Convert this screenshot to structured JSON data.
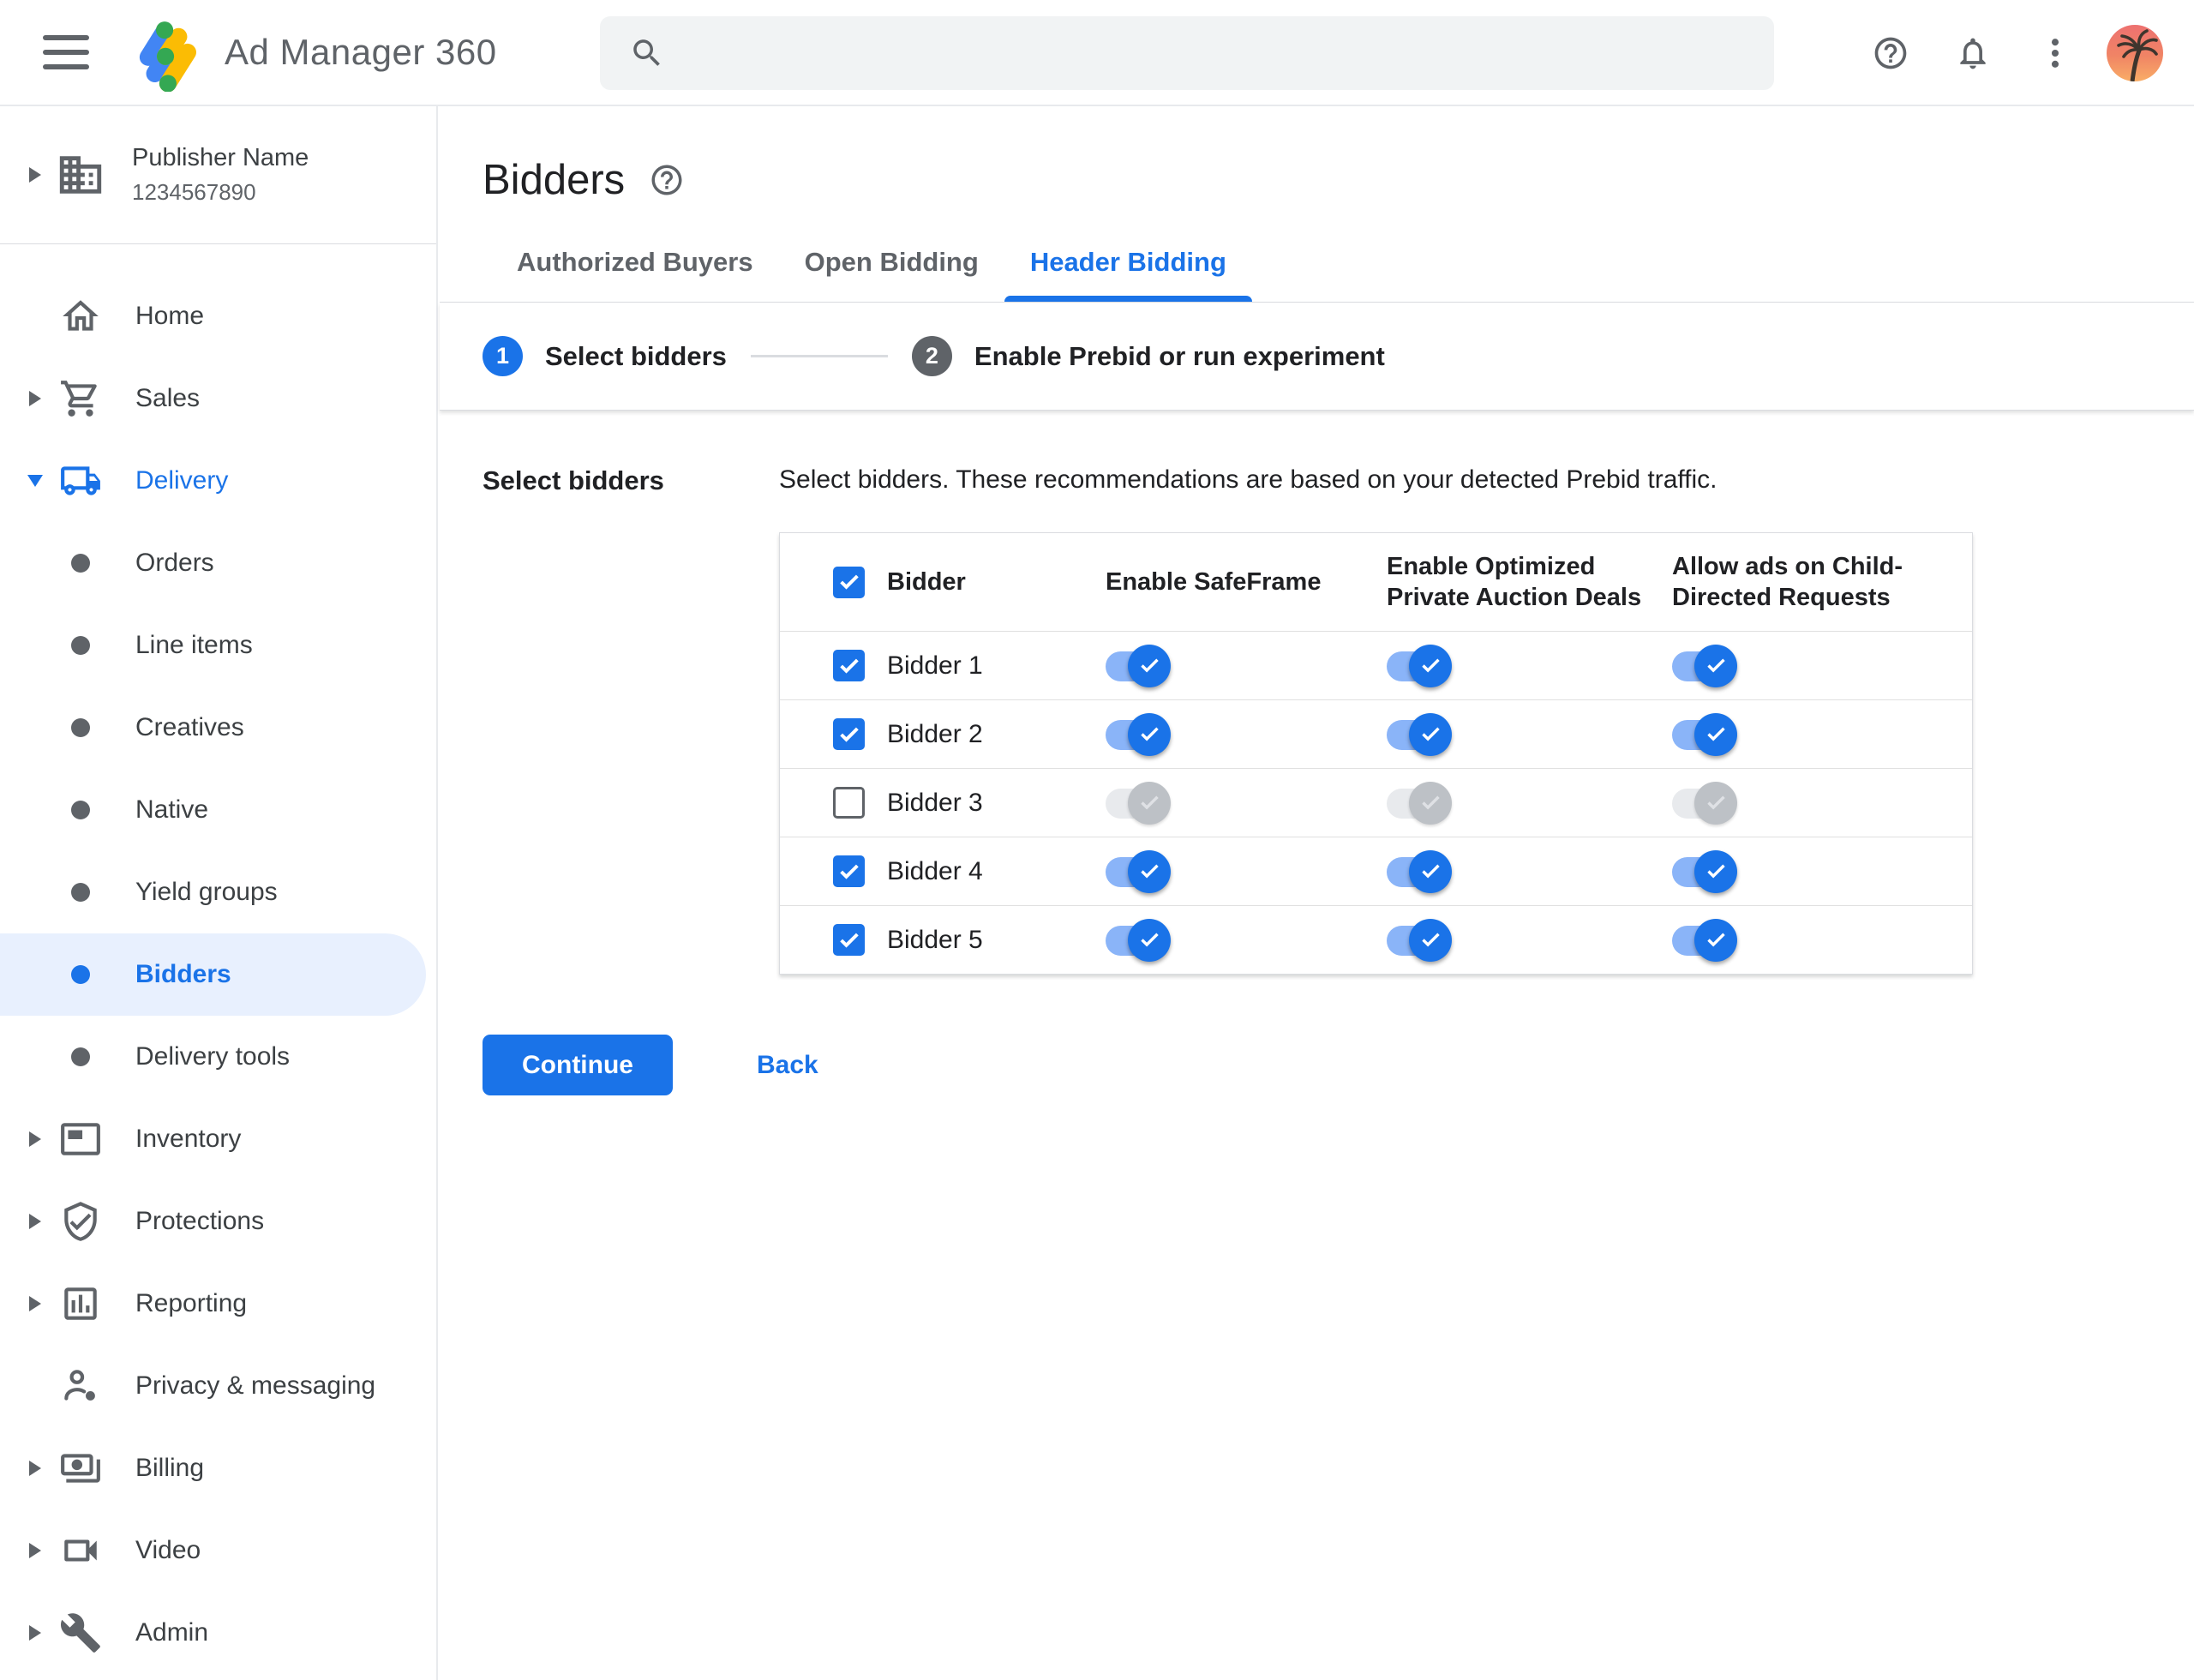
{
  "topbar": {
    "product_name": "Ad Manager 360",
    "search_value": "",
    "search_placeholder": ""
  },
  "account": {
    "name": "Publisher Name",
    "id": "1234567890"
  },
  "sidebar": {
    "items": [
      {
        "label": "Home",
        "icon": "home-icon",
        "kind": "parent",
        "arrow": "none",
        "highlighted": false,
        "selected": false
      },
      {
        "label": "Sales",
        "icon": "cart-icon",
        "kind": "parent",
        "arrow": "collapsed",
        "highlighted": false,
        "selected": false
      },
      {
        "label": "Delivery",
        "icon": "truck-icon",
        "kind": "parent",
        "arrow": "expanded",
        "highlighted": true,
        "selected": false
      },
      {
        "label": "Orders",
        "icon": "bullet",
        "kind": "sub",
        "arrow": "none",
        "highlighted": false,
        "selected": false
      },
      {
        "label": "Line items",
        "icon": "bullet",
        "kind": "sub",
        "arrow": "none",
        "highlighted": false,
        "selected": false
      },
      {
        "label": "Creatives",
        "icon": "bullet",
        "kind": "sub",
        "arrow": "none",
        "highlighted": false,
        "selected": false
      },
      {
        "label": "Native",
        "icon": "bullet",
        "kind": "sub",
        "arrow": "none",
        "highlighted": false,
        "selected": false
      },
      {
        "label": "Yield groups",
        "icon": "bullet",
        "kind": "sub",
        "arrow": "none",
        "highlighted": false,
        "selected": false
      },
      {
        "label": "Bidders",
        "icon": "bullet",
        "kind": "sub",
        "arrow": "none",
        "highlighted": false,
        "selected": true
      },
      {
        "label": "Delivery tools",
        "icon": "bullet",
        "kind": "sub",
        "arrow": "none",
        "highlighted": false,
        "selected": false
      },
      {
        "label": "Inventory",
        "icon": "ad-unit-icon",
        "kind": "parent",
        "arrow": "collapsed",
        "highlighted": false,
        "selected": false
      },
      {
        "label": "Protections",
        "icon": "shield-check-icon",
        "kind": "parent",
        "arrow": "collapsed",
        "highlighted": false,
        "selected": false
      },
      {
        "label": "Reporting",
        "icon": "bar-chart-icon",
        "kind": "parent",
        "arrow": "collapsed",
        "highlighted": false,
        "selected": false
      },
      {
        "label": "Privacy & messaging",
        "icon": "person-badge-icon",
        "kind": "parent",
        "arrow": "none",
        "highlighted": false,
        "selected": false
      },
      {
        "label": "Billing",
        "icon": "payments-icon",
        "kind": "parent",
        "arrow": "collapsed",
        "highlighted": false,
        "selected": false
      },
      {
        "label": "Video",
        "icon": "videocam-icon",
        "kind": "parent",
        "arrow": "collapsed",
        "highlighted": false,
        "selected": false
      },
      {
        "label": "Admin",
        "icon": "wrench-icon",
        "kind": "parent",
        "arrow": "collapsed",
        "highlighted": false,
        "selected": false
      }
    ]
  },
  "page": {
    "title": "Bidders"
  },
  "tabs": [
    {
      "label": "Authorized Buyers",
      "active": false
    },
    {
      "label": "Open Bidding",
      "active": false
    },
    {
      "label": "Header Bidding",
      "active": true
    }
  ],
  "stepper": {
    "steps": [
      {
        "number": "1",
        "label": "Select bidders",
        "state": "active"
      },
      {
        "number": "2",
        "label": "Enable Prebid or run experiment",
        "state": "upcoming"
      }
    ]
  },
  "section": {
    "label": "Select bidders",
    "description": "Select bidders. These recommendations are based on your detected Prebid traffic."
  },
  "table": {
    "header": {
      "select_all_checked": true,
      "columns": [
        "Bidder",
        "Enable SafeFrame",
        "Enable Optimized Private Auction Deals",
        "Allow ads on Child-Directed Requests"
      ]
    },
    "rows": [
      {
        "name": "Bidder 1",
        "checked": true,
        "enable_safeframe": "on",
        "optimized_private_auction_deals": "on",
        "allow_ads_child_directed": "on"
      },
      {
        "name": "Bidder 2",
        "checked": true,
        "enable_safeframe": "on",
        "optimized_private_auction_deals": "on",
        "allow_ads_child_directed": "on"
      },
      {
        "name": "Bidder 3",
        "checked": false,
        "enable_safeframe": "disabled",
        "optimized_private_auction_deals": "disabled",
        "allow_ads_child_directed": "disabled"
      },
      {
        "name": "Bidder 4",
        "checked": true,
        "enable_safeframe": "on",
        "optimized_private_auction_deals": "on",
        "allow_ads_child_directed": "on"
      },
      {
        "name": "Bidder 5",
        "checked": true,
        "enable_safeframe": "on",
        "optimized_private_auction_deals": "on",
        "allow_ads_child_directed": "on"
      }
    ]
  },
  "actions": {
    "continue_label": "Continue",
    "back_label": "Back"
  },
  "colors": {
    "accent_blue": "#1a73e8",
    "toggle_track_on": "#8ab4f8",
    "toggle_thumb_disabled": "#bdc1c6",
    "toggle_track_disabled": "#e8eaed",
    "selected_item_bg": "#e8f0fe",
    "logo_blue": "#4285f4",
    "logo_yellow": "#fbbc04",
    "logo_green": "#34a853"
  }
}
